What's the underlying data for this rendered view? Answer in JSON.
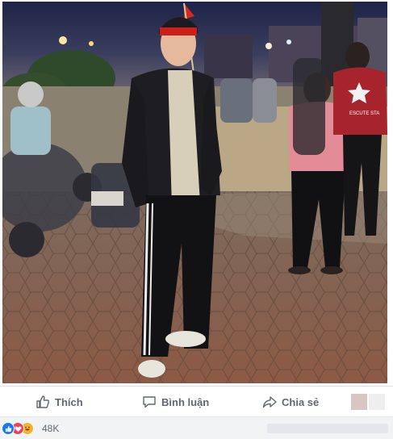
{
  "actions": {
    "like_label": "Thích",
    "comment_label": "Bình luận",
    "share_label": "Chia sẻ"
  },
  "reactions": {
    "count": "48K",
    "types": [
      "like",
      "love",
      "haha"
    ]
  },
  "colors": {
    "like_blue": "#1877f2",
    "love_red": "#f33e58",
    "haha_yellow": "#f7b125",
    "action_text": "#606770"
  },
  "photo": {
    "visible_text": [
      "ESCUTE STA"
    ]
  }
}
